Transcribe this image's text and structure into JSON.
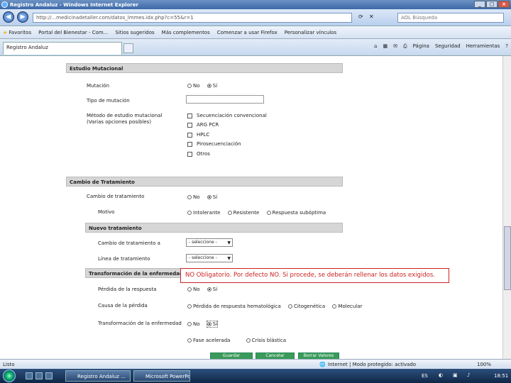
{
  "window": {
    "title": "Registro Andaluz - Windows Internet Explorer",
    "url": "http://...medicinadetaller.com/datos_lmmes.idx.php?c=55&r=1",
    "search_placeholder": "AOL Búsqueda"
  },
  "favorites": {
    "label": "Favoritos",
    "items": [
      "Portal del Bienestar - Com...",
      "Sitios sugeridos",
      "Más complementos",
      "Comenzar a usar Firefox",
      "Personalizar vínculos"
    ]
  },
  "tab": {
    "label": "Registro Andaluz"
  },
  "commands": [
    "Página",
    "Seguridad",
    "Herramientas"
  ],
  "form": {
    "estudio": {
      "title": "Estudio Mutacional",
      "mutacion_label": "Mutación",
      "no": "No",
      "si": "Sí",
      "tipo_label": "Tipo de mutación",
      "metodo_label": "Método de estudio mutacional",
      "metodo_sub": "(Varias opciones posibles)",
      "metodos": [
        "Secuenciación convencional",
        "ARG PCR",
        "HPLC",
        "Pirosecuenciación",
        "Otros"
      ]
    },
    "cambio": {
      "title": "Cambio de Tratamiento",
      "cambio_label": "Cambio de tratamiento",
      "no": "No",
      "si": "Sí",
      "motivo_label": "Motivo",
      "motivos": [
        "Intolerante",
        "Resistente",
        "Respuesta subóptima"
      ]
    },
    "nuevo": {
      "title": "Nuevo tratamiento",
      "cambio_a_label": "Cambio de tratamiento a",
      "linea_label": "Línea de tratamiento",
      "select_value": "- seleccione -"
    },
    "transf": {
      "title": "Transformación de la enfermedad",
      "perdida_label": "Pérdida de la respuesta",
      "no": "No",
      "si": "Sí",
      "causa_label": "Causa de la pérdida",
      "causas": [
        "Pérdida de respuesta hematológica",
        "Citogenética",
        "Molecular"
      ],
      "transf_label": "Transformación de la enfermedad",
      "fases": [
        "Fase acelerada",
        "Crisis blástica"
      ]
    },
    "buttons": [
      "Guardar",
      "Cancelar",
      "Borrar Valores"
    ]
  },
  "tooltip": "NO Obligatorio. Por defecto NO. Si procede, se deberán rellenar los datos exigidos.",
  "status": {
    "left": "Listo",
    "zone": "Internet | Modo protegido: activado",
    "zoom": "100%"
  },
  "taskbar": {
    "items": [
      "Registro Andaluz ...",
      "Microsoft PowerPoi..."
    ],
    "lang": "ES",
    "time": "18:51"
  }
}
